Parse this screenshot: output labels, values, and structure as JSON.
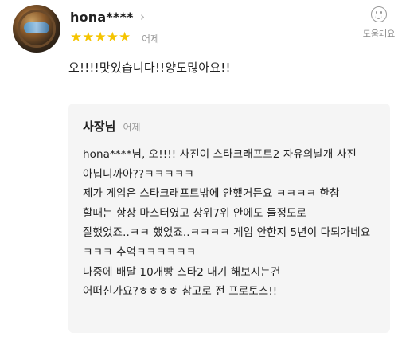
{
  "review": {
    "username": "hona****",
    "rating": 5,
    "date": "어제",
    "text": "오!!!!맛있습니다!!양도많아요!!"
  },
  "helpful": {
    "label": "도움돼요"
  },
  "reply": {
    "author": "사장님",
    "date": "어제",
    "lines": [
      "hona****님, 오!!!! 사진이 스타크래프트2 자유의날개 사진",
      "아닙니까아??ㅋㅋㅋㅋㅋ",
      "제가 게임은 스타크래프트밖에 안했거든요 ㅋㅋㅋㅋ 한참",
      "할때는 항상 마스터였고 상위7위 안에도 들정도로",
      "잘했었죠..ㅋㅋ 했었죠..ㅋㅋㅋㅋ 게임 안한지 5년이 다되가네요",
      "ㅋㅋㅋ 추억ㅋㅋㅋㅋㅋㅋ",
      "나중에 배달 10개빵 스타2 내기 해보시는건",
      "어떠신가요?ㅎㅎㅎㅎ 참고로 전 프로토스!!"
    ]
  },
  "icons": {
    "avatar": "starcraft-marine-avatar",
    "star": "star-icon",
    "helpful": "smiley-icon",
    "chevron": "chevron-right-icon"
  },
  "colors": {
    "star": "#f5c400",
    "reply_bg": "#f5f5f5"
  }
}
